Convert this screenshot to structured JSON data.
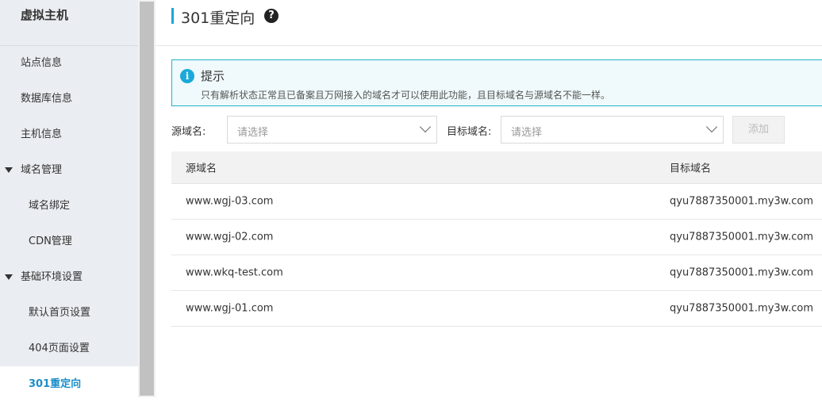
{
  "sidebar": {
    "title": "虚拟主机",
    "items": [
      {
        "label": "站点信息"
      },
      {
        "label": "数据库信息"
      },
      {
        "label": "主机信息"
      },
      {
        "label": "域名管理"
      },
      {
        "label": "域名绑定"
      },
      {
        "label": "CDN管理"
      },
      {
        "label": "基础环境设置"
      },
      {
        "label": "默认首页设置"
      },
      {
        "label": "404页面设置"
      },
      {
        "label": "301重定向"
      }
    ]
  },
  "header": {
    "title": "301重定向",
    "help_icon": "?"
  },
  "tip": {
    "icon": "i",
    "title": "提示",
    "text": "只有解析状态正常且已备案且万网接入的域名才可以使用此功能，且目标域名与源域名不能一样。"
  },
  "form": {
    "source_label": "源域名:",
    "source_placeholder": "请选择",
    "target_label": "目标域名:",
    "target_placeholder": "请选择",
    "add_label": "添加"
  },
  "table": {
    "columns": [
      "源域名",
      "目标域名"
    ],
    "rows": [
      [
        "www.wgj-03.com",
        "qyu7887350001.my3w.com"
      ],
      [
        "www.wgj-02.com",
        "qyu7887350001.my3w.com"
      ],
      [
        "www.wkq-test.com",
        "qyu7887350001.my3w.com"
      ],
      [
        "www.wgj-01.com",
        "qyu7887350001.my3w.com"
      ]
    ]
  },
  "colors": {
    "accent": "#1b8ec8",
    "tip_border": "#22b3c8",
    "sidebar_bg": "#eaedf1"
  }
}
